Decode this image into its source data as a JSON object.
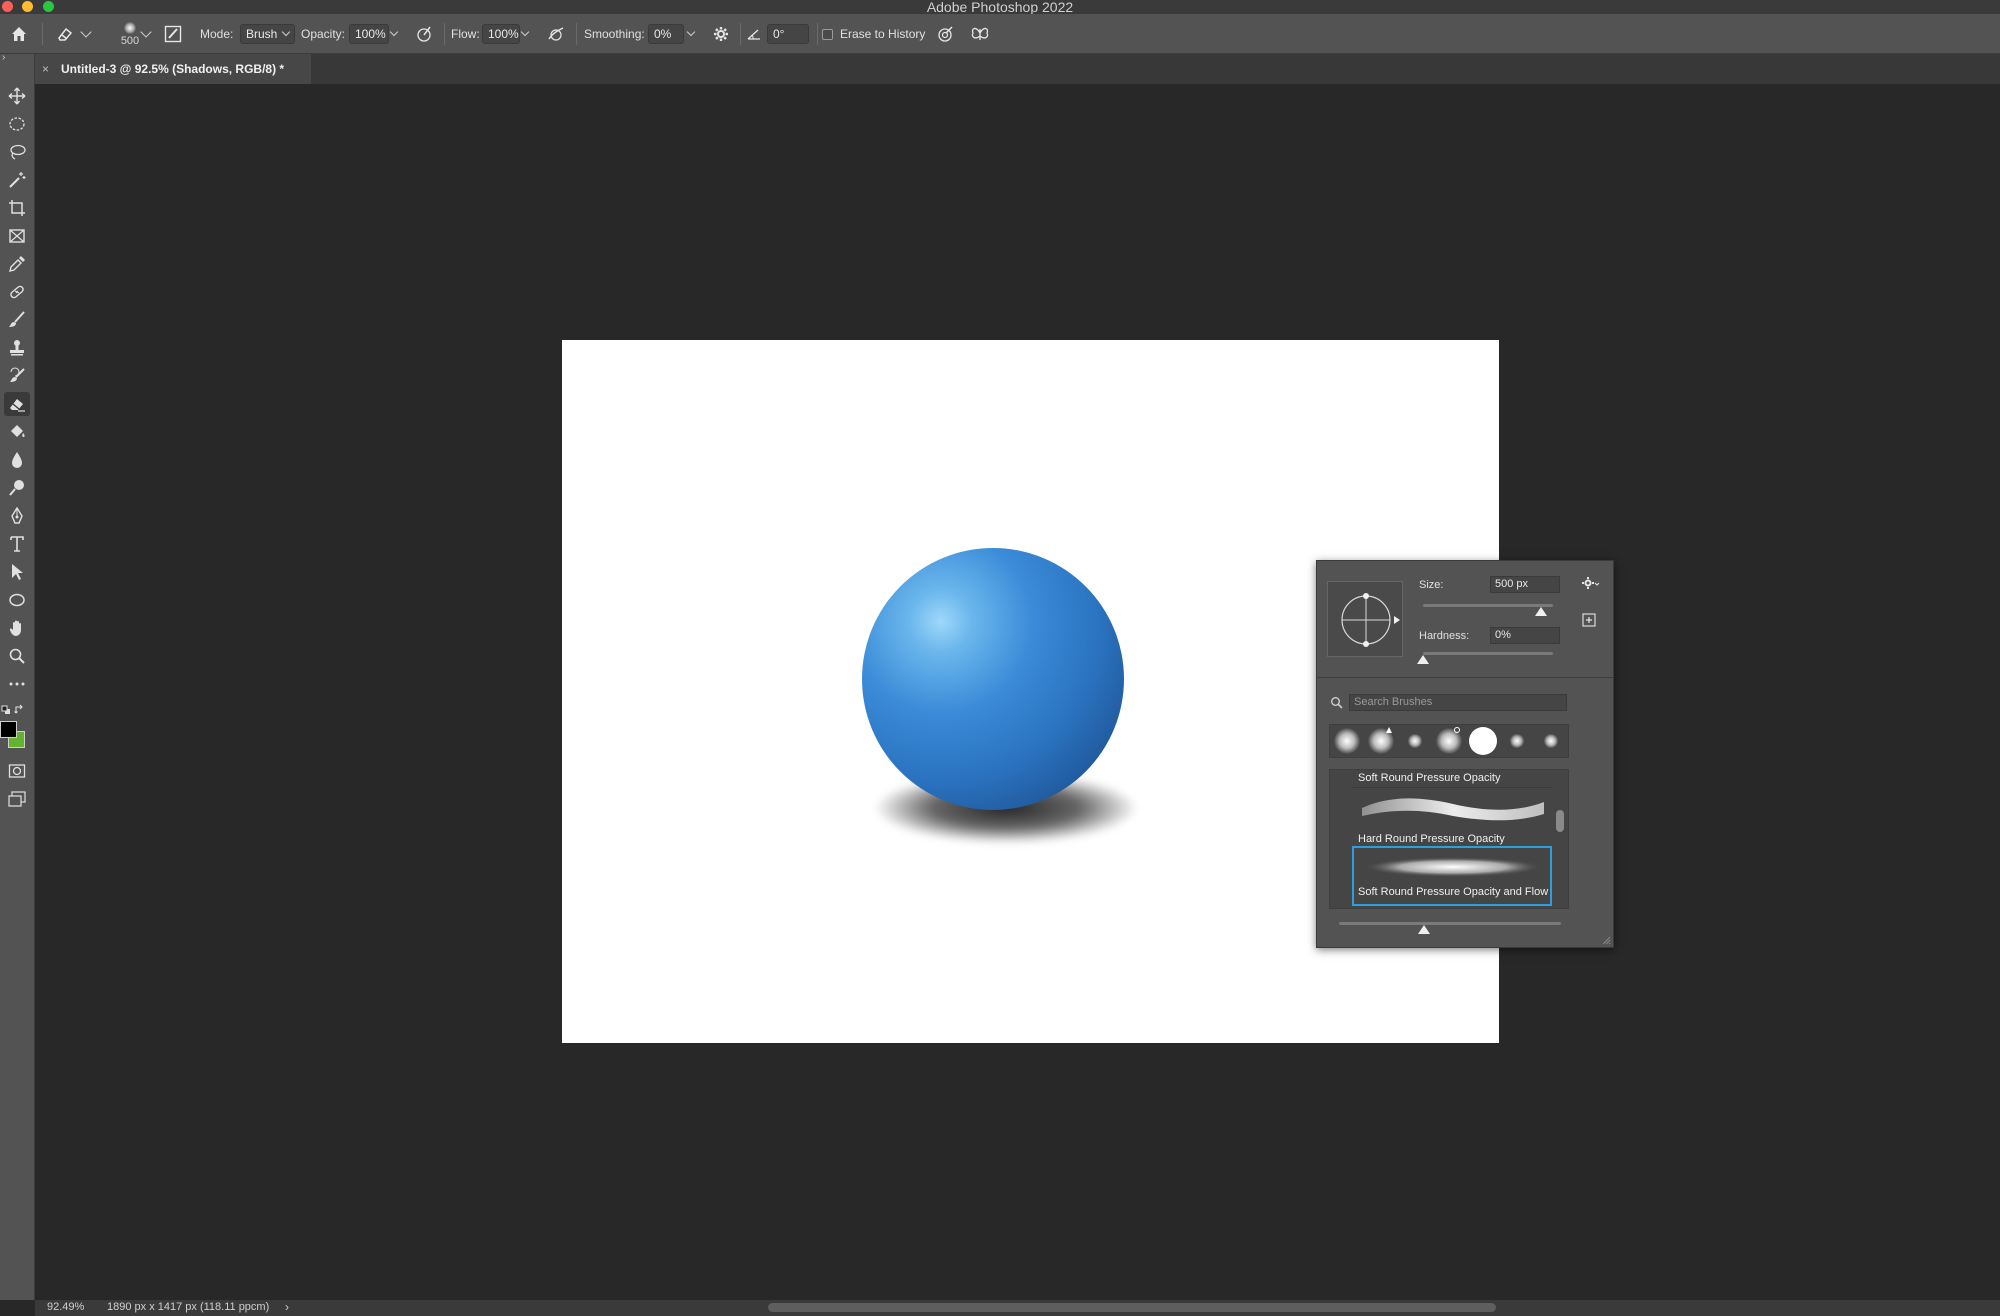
{
  "app": {
    "title": "Adobe Photoshop 2022"
  },
  "window_controls": {
    "close_color": "#fe5f57",
    "minimize_color": "#febc2e",
    "zoom_color": "#28c840"
  },
  "options_bar": {
    "brush_size": "500",
    "mode_label": "Mode:",
    "mode_value": "Brush",
    "opacity_label": "Opacity:",
    "opacity_value": "100%",
    "flow_label": "Flow:",
    "flow_value": "100%",
    "smoothing_label": "Smoothing:",
    "smoothing_value": "0%",
    "angle_value": "0°",
    "erase_to_history_label": "Erase to History",
    "erase_to_history_checked": false
  },
  "document": {
    "tab_close": "×",
    "tab_title": "Untitled-3 @ 92.5% (Shadows, RGB/8) *",
    "sphere_colors": {
      "highlight": "#9fd8fa",
      "mid": "#2b73c0",
      "dark": "#163f73"
    }
  },
  "toolbar": {
    "tools": [
      "move-icon",
      "marquee-ellipse-icon",
      "lasso-icon",
      "magic-wand-icon",
      "crop-icon",
      "frame-icon",
      "eyedropper-icon",
      "healing-brush-icon",
      "brush-icon",
      "clone-stamp-icon",
      "history-brush-icon",
      "eraser-icon",
      "paint-bucket-icon",
      "blur-icon",
      "dodge-icon",
      "pen-icon",
      "type-icon",
      "path-selection-icon",
      "ellipse-icon",
      "hand-icon",
      "zoom-icon",
      "more-tools-icon"
    ],
    "active_tool": "eraser-icon",
    "foreground_color": "#000000",
    "background_color": "#63b32f"
  },
  "brush_popup": {
    "size_label": "Size:",
    "size_value": "500 px",
    "hardness_label": "Hardness:",
    "hardness_value": "0%",
    "search_placeholder": "Search Brushes",
    "brushes": [
      {
        "name": "Soft Round Pressure Opacity"
      },
      {
        "name": "Hard Round Pressure Opacity"
      },
      {
        "name": "Soft Round Pressure Opacity and Flow",
        "selected": true
      }
    ]
  },
  "status_bar": {
    "zoom": "92.49%",
    "doc_info": "1890 px x 1417 px (118.11 ppcm)",
    "arrow": "›"
  }
}
